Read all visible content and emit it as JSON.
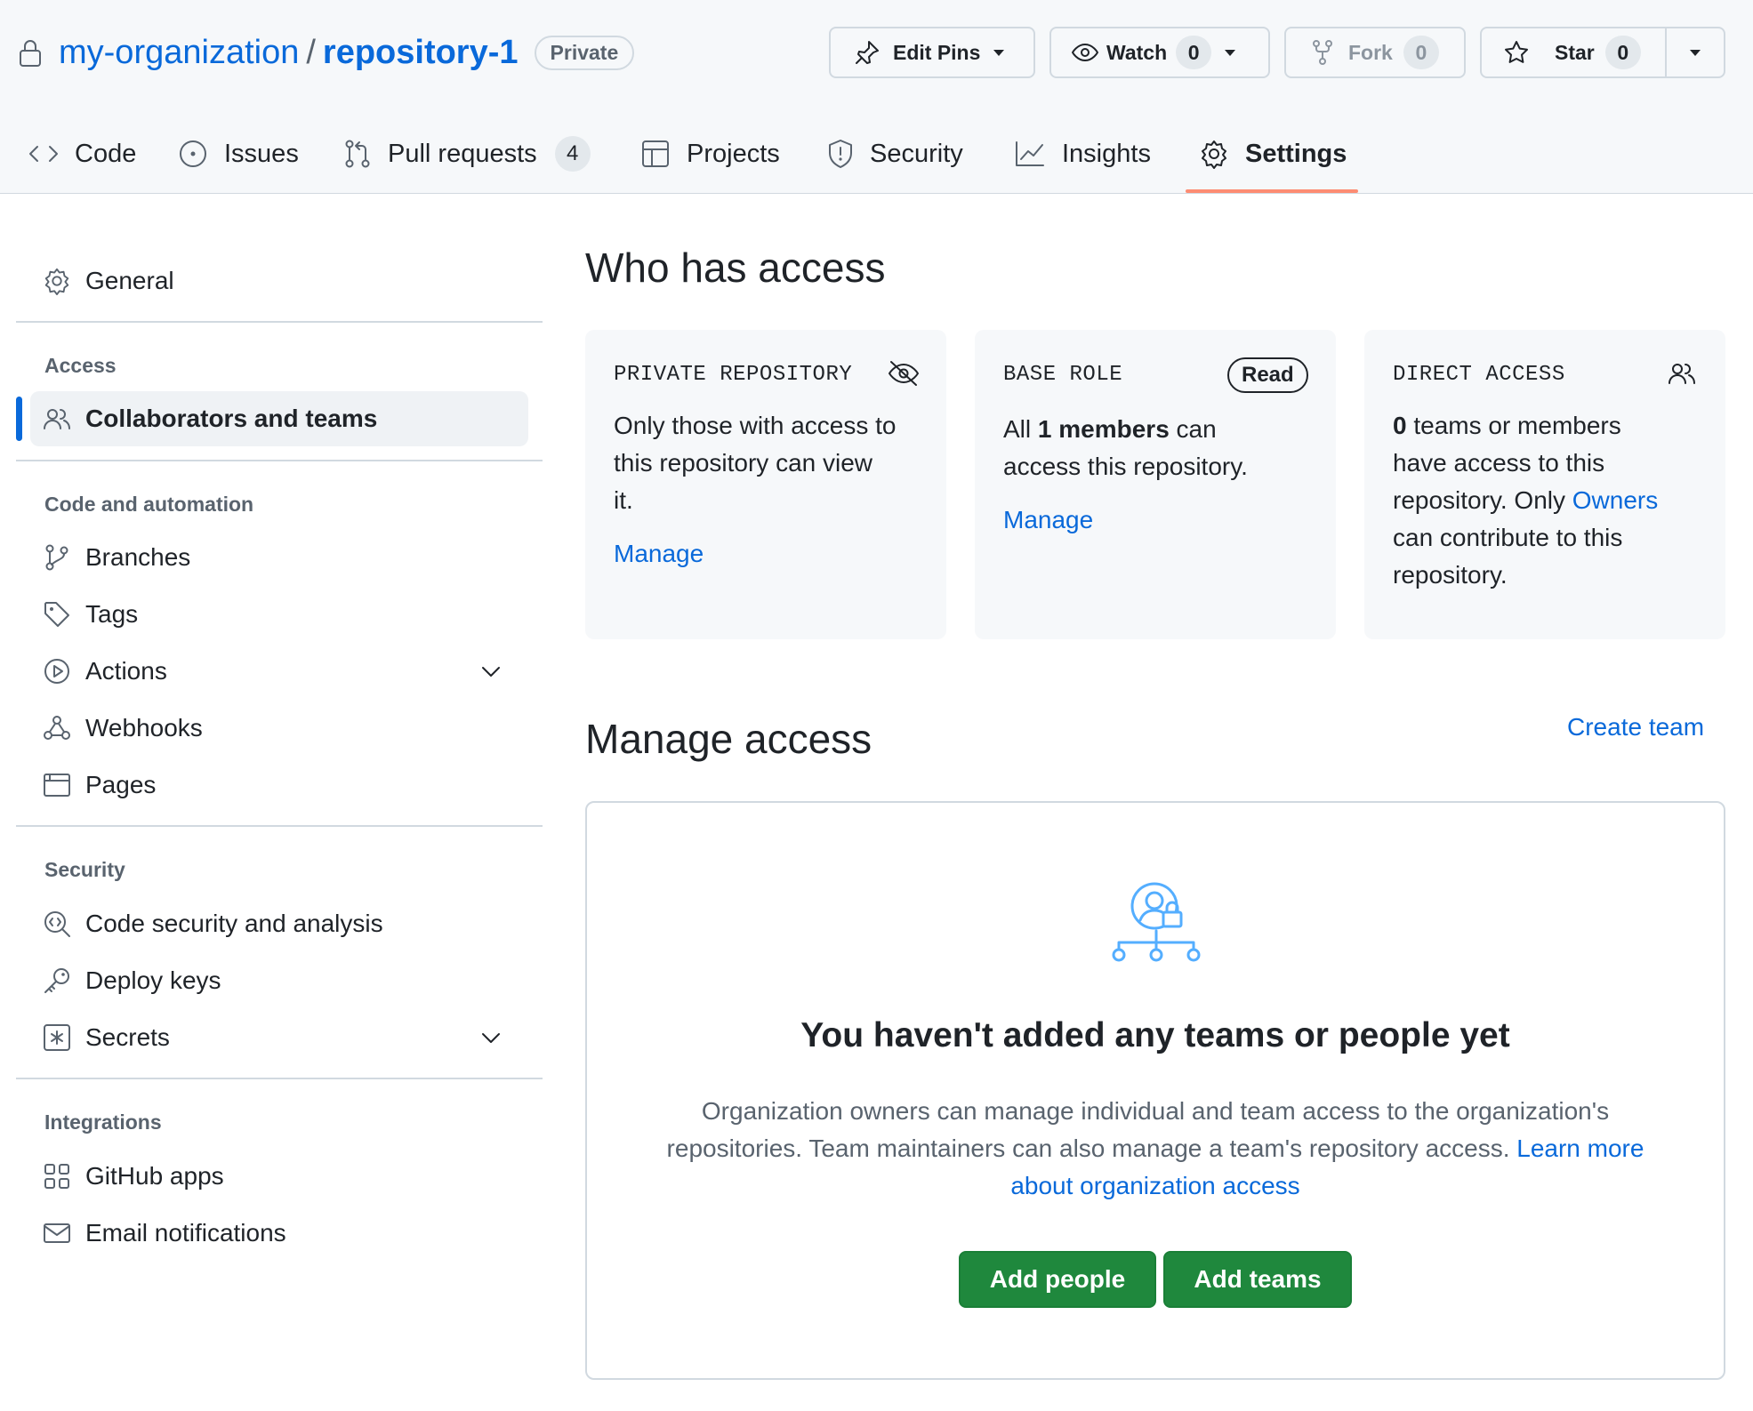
{
  "header": {
    "org": "my-organization",
    "separator": "/",
    "repo": "repository-1",
    "visibility_badge": "Private",
    "edit_pins_label": "Edit Pins",
    "watch_label": "Watch",
    "watch_count": "0",
    "fork_label": "Fork",
    "fork_count": "0",
    "star_label": "Star",
    "star_count": "0"
  },
  "tabs": [
    {
      "label": "Code",
      "icon": "code-icon"
    },
    {
      "label": "Issues",
      "icon": "issue-icon"
    },
    {
      "label": "Pull requests",
      "icon": "pull-request-icon",
      "count": "4"
    },
    {
      "label": "Projects",
      "icon": "table-icon"
    },
    {
      "label": "Security",
      "icon": "shield-icon"
    },
    {
      "label": "Insights",
      "icon": "graph-icon"
    },
    {
      "label": "Settings",
      "icon": "gear-icon",
      "selected": true
    }
  ],
  "sidebar": {
    "general": "General",
    "sections": [
      {
        "heading": "Access",
        "items": [
          {
            "label": "Collaborators and teams",
            "icon": "people-icon",
            "selected": true
          }
        ]
      },
      {
        "heading": "Code and automation",
        "items": [
          {
            "label": "Branches",
            "icon": "git-branch-icon"
          },
          {
            "label": "Tags",
            "icon": "tag-icon"
          },
          {
            "label": "Actions",
            "icon": "play-icon"
          },
          {
            "label": "Webhooks",
            "icon": "webhook-icon"
          },
          {
            "label": "Pages",
            "icon": "browser-icon"
          }
        ]
      },
      {
        "heading": "Security",
        "items": [
          {
            "label": "Code security and analysis",
            "icon": "codescan-icon"
          },
          {
            "label": "Deploy keys",
            "icon": "key-icon"
          },
          {
            "label": "Secrets",
            "icon": "asterisk-icon"
          }
        ]
      },
      {
        "heading": "Integrations",
        "items": [
          {
            "label": "GitHub apps",
            "icon": "apps-icon"
          },
          {
            "label": "Email notifications",
            "icon": "mail-icon"
          }
        ]
      }
    ]
  },
  "main": {
    "who_has_access_title": "Who has access",
    "cards": {
      "private": {
        "title": "PRIVATE REPOSITORY",
        "line1": "Only those with access to",
        "line2": "this repository can view",
        "line3": "it.",
        "link": "Manage"
      },
      "base_role": {
        "title": "BASE ROLE",
        "badge": "Read",
        "text_pre": "All ",
        "text_bold": "1 members",
        "text_post": " can",
        "line2": "access this repository.",
        "link": "Manage"
      },
      "direct": {
        "title": "DIRECT ACCESS",
        "count": "0",
        "line1_rest": " teams or members",
        "line2": "have access to this",
        "line3_pre": "repository. Only ",
        "owners_link": "Owners",
        "line4": "can contribute to this",
        "line5": "repository."
      }
    },
    "manage_access_title": "Manage access",
    "create_team_link": "Create team",
    "empty_state": {
      "heading": "You haven't added any teams or people yet",
      "line1": "Organization owners can manage individual and team access to the organization's",
      "line2_pre": "repositories. Team maintainers can also manage a team's repository access. ",
      "learn_more_a": "Learn more",
      "learn_more_b": "about organization access",
      "add_people": "Add people",
      "add_teams": "Add teams"
    }
  },
  "colors": {
    "accent_blue": "#0969da",
    "tab_underline": "#fd8c73",
    "selected_bar": "#0969da",
    "green_button": "#1f883d",
    "illustration_blue": "#54aeff"
  }
}
